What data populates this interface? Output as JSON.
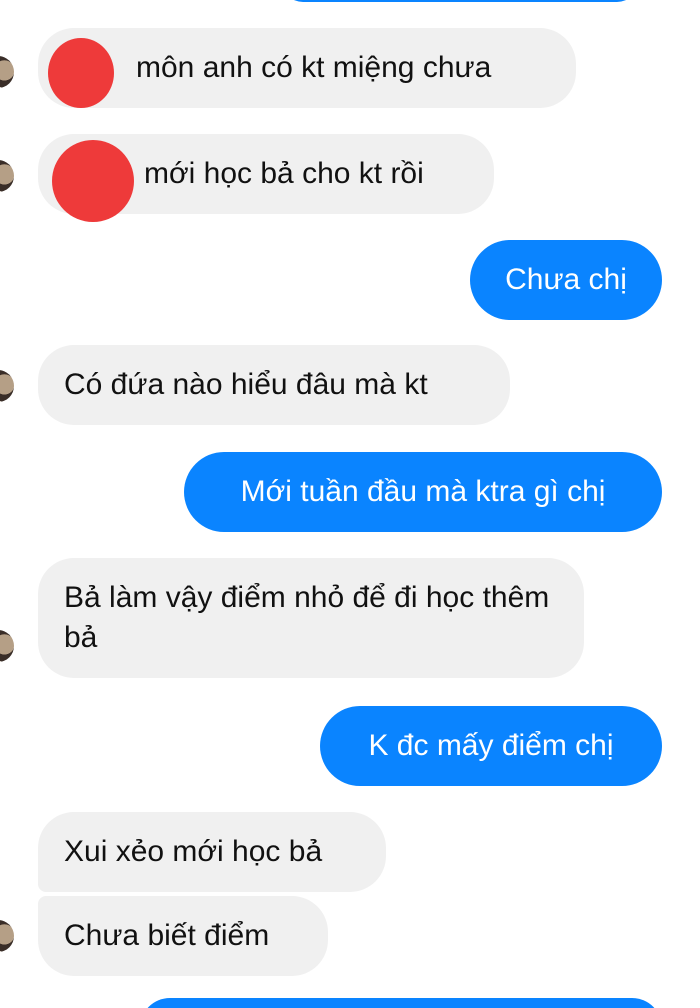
{
  "colors": {
    "incoming_bubble": "#f0f0f0",
    "outgoing_bubble": "#0a84ff",
    "redaction_mark": "#ee3a3a"
  },
  "messages": [
    {
      "side": "incoming",
      "text": "môn anh có kt miệng chưa"
    },
    {
      "side": "incoming",
      "text": "mới học bả cho kt rồi"
    },
    {
      "side": "outgoing",
      "text": "Chưa chị"
    },
    {
      "side": "incoming",
      "text": "Có đứa nào hiểu đâu mà kt"
    },
    {
      "side": "outgoing",
      "text": "Mới tuần đầu mà ktra gì chị"
    },
    {
      "side": "incoming",
      "text": "Bả làm vậy điểm nhỏ để đi học thêm bả"
    },
    {
      "side": "outgoing",
      "text": "K đc mấy điểm chị"
    },
    {
      "side": "incoming",
      "text": "Xui xẻo mới học bả"
    },
    {
      "side": "incoming",
      "text": "Chưa biết điểm"
    }
  ]
}
